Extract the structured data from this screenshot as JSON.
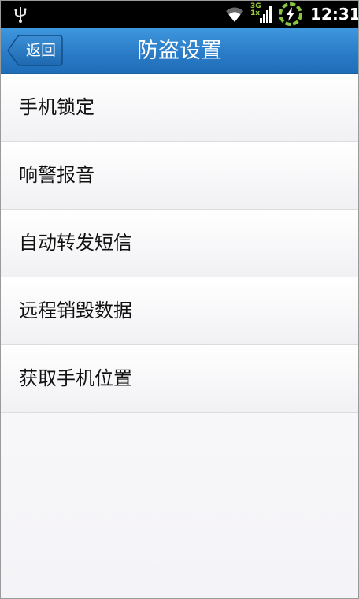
{
  "status_bar": {
    "icons": [
      "usb-icon",
      "wifi-icon",
      "signal-icon",
      "sync-icon"
    ],
    "network_type_top": "3G",
    "network_type_bottom": "1x",
    "time": "12:31"
  },
  "header": {
    "back_label": "返回",
    "title": "防盗设置"
  },
  "menu": {
    "items": [
      {
        "label": "手机锁定"
      },
      {
        "label": "响警报音"
      },
      {
        "label": "自动转发短信"
      },
      {
        "label": "远程销毁数据"
      },
      {
        "label": "获取手机位置"
      }
    ]
  },
  "colors": {
    "header_top": "#3f97dd",
    "header_bottom": "#1f6db8",
    "status_bar": "#000000",
    "sync_accent": "#8bc53f"
  }
}
